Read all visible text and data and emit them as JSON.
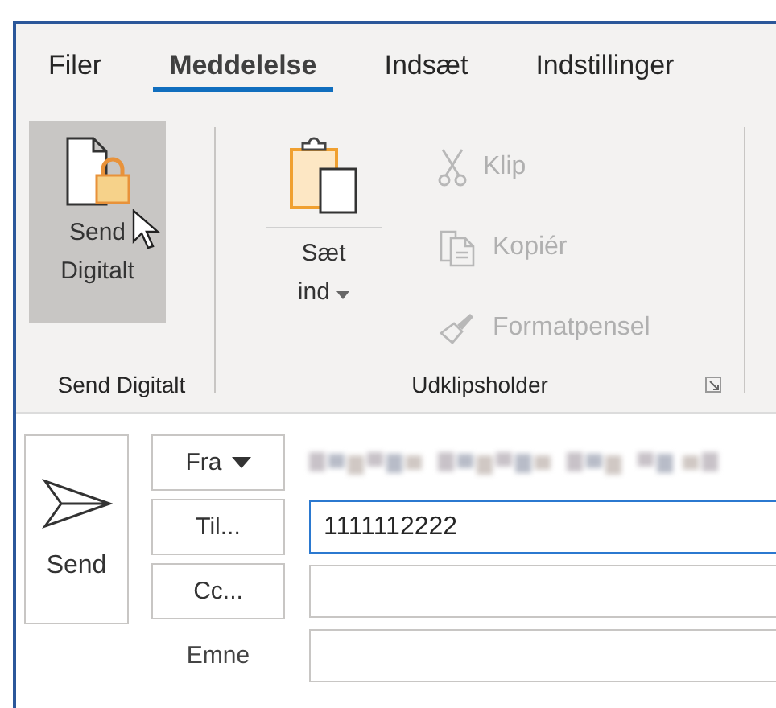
{
  "tabs": [
    {
      "label": "Filer",
      "selected": false
    },
    {
      "label": "Meddelelse",
      "selected": true
    },
    {
      "label": "Indsæt",
      "selected": false
    },
    {
      "label": "Indstillinger",
      "selected": false
    }
  ],
  "ribbon": {
    "send_digitalt": {
      "label_lines": [
        "Send",
        "Digitalt"
      ],
      "hovered": true,
      "group_label": "Send Digitalt"
    },
    "clipboard": {
      "paste_lines": [
        "Sæt",
        "ind"
      ],
      "group_label": "Udklipsholder",
      "items": [
        {
          "kind": "cut",
          "label": "Klip",
          "disabled": true
        },
        {
          "kind": "copy",
          "label": "Kopiér",
          "disabled": true
        },
        {
          "kind": "brush",
          "label": "Formatpensel",
          "disabled": true
        }
      ]
    }
  },
  "compose": {
    "send_button": "Send",
    "from_button": "Fra",
    "to_button": "Til...",
    "to_value": "1111112222",
    "cc_button": "Cc...",
    "subject_label": "Emne"
  }
}
